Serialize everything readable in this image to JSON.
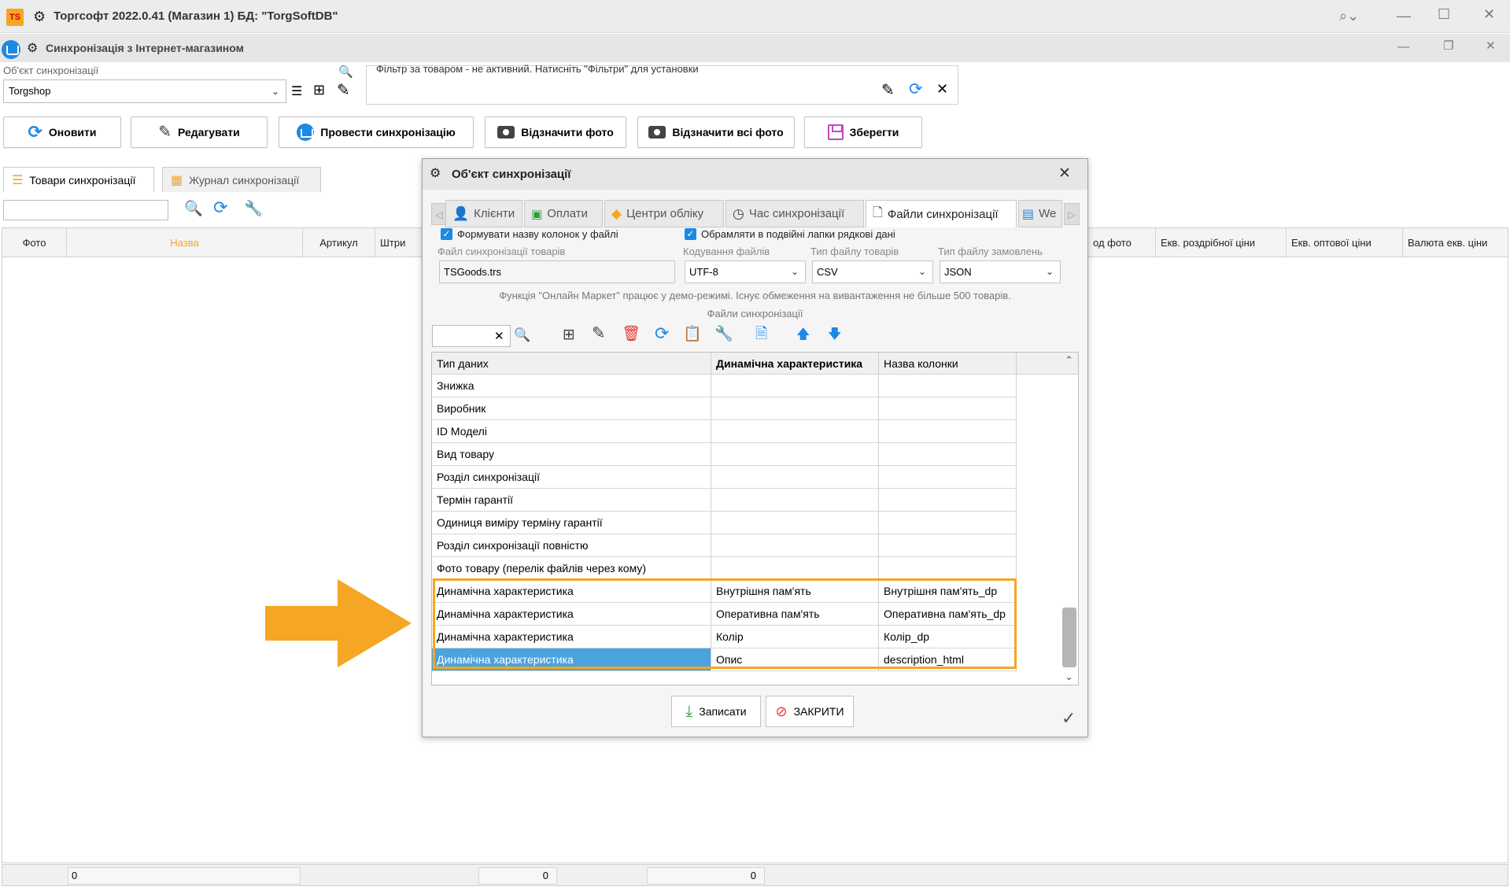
{
  "app": {
    "title": "Торгсофт 2022.0.41 (Магазин 1) БД: \"TorgSoftDB\"",
    "logo": "TS",
    "window_title": "Синхронізація з Інтернет-магазином"
  },
  "object_select": {
    "label": "Об'єкт синхронізації",
    "value": "Torgshop"
  },
  "filter": {
    "text": "Фільтр за товаром - не активний. Натисніть \"Фільтри\" для установки"
  },
  "toolbar": {
    "refresh": "Оновити",
    "edit": "Редагувати",
    "sync": "Провести синхронізацію",
    "mark_photo": "Відзначити фото",
    "mark_all_photo": "Відзначити всі фото",
    "save": "Зберегти"
  },
  "main_tabs": [
    {
      "label": "Товари синхронізації"
    },
    {
      "label": "Журнал синхронізації"
    }
  ],
  "grid_columns": {
    "photo": "Фото",
    "name": "Назва",
    "article": "Артикул",
    "barcode": "Штри",
    "photo_code": "од фото",
    "retail_eq": "Екв. роздрібної ціни",
    "wholesale_eq": "Екв. оптової ціни",
    "currency_eq": "Валюта екв. ціни"
  },
  "status": {
    "cell1": "0",
    "cell2": "0",
    "cell3": "0"
  },
  "dialog": {
    "title": "Об'єкт синхронізації",
    "tabs": [
      {
        "label": "Клієнти"
      },
      {
        "label": "Оплати"
      },
      {
        "label": "Центри обліку"
      },
      {
        "label": "Час синхронізації"
      },
      {
        "label": "Файли синхронізації"
      },
      {
        "label": "We"
      }
    ],
    "opt_columns": "Формувати назву колонок у файлі",
    "opt_quotes": "Обрамляти в подвійні лапки рядкові дані",
    "goods_file_label": "Файл синхронізації товарів",
    "goods_file_value": "TSGoods.trs",
    "encoding_label": "Кодування файлів",
    "encoding_value": "UTF-8",
    "goods_type_label": "Тип файлу товарів",
    "goods_type_value": "CSV",
    "orders_type_label": "Тип файлу замовлень",
    "orders_type_value": "JSON",
    "demo_note": "Функція \"Онлайн Маркет\" працює у демо-режимі. Існує обмеження на вивантаження не більше 500 товарів.",
    "files_caption": "Файли синхронізації",
    "table": {
      "headers": {
        "type": "Тип даних",
        "dyn": "Динамічна характеристика",
        "col": "Назва колонки"
      },
      "rows": [
        {
          "type": "Знижка",
          "dyn": "",
          "col": ""
        },
        {
          "type": "Виробник",
          "dyn": "",
          "col": ""
        },
        {
          "type": "ID Моделі",
          "dyn": "",
          "col": ""
        },
        {
          "type": "Вид товару",
          "dyn": "",
          "col": ""
        },
        {
          "type": "Розділ синхронізації",
          "dyn": "",
          "col": ""
        },
        {
          "type": "Термін гарантії",
          "dyn": "",
          "col": ""
        },
        {
          "type": "Одиниця виміру терміну гарантії",
          "dyn": "",
          "col": ""
        },
        {
          "type": "Розділ синхронізації повністю",
          "dyn": "",
          "col": ""
        },
        {
          "type": "Фото товару (перелік файлів через кому)",
          "dyn": "",
          "col": ""
        },
        {
          "type": "Динамічна характеристика",
          "dyn": "Внутрішня пам'ять",
          "col": "Внутрішня пам'ять_dp"
        },
        {
          "type": "Динамічна характеристика",
          "dyn": "Оперативна пам'ять",
          "col": "Оперативна пам'ять_dp"
        },
        {
          "type": "Динамічна характеристика",
          "dyn": "Колір",
          "col": "Колір_dp"
        },
        {
          "type": "Динамічна характеристика",
          "dyn": "Опис",
          "col": "description_html"
        }
      ]
    },
    "save_btn": "Записати",
    "close_btn": "ЗАКРИТИ"
  },
  "colors": {
    "accent": "#1e88e5",
    "highlight": "#f5a623",
    "selection": "#4aa3df"
  }
}
